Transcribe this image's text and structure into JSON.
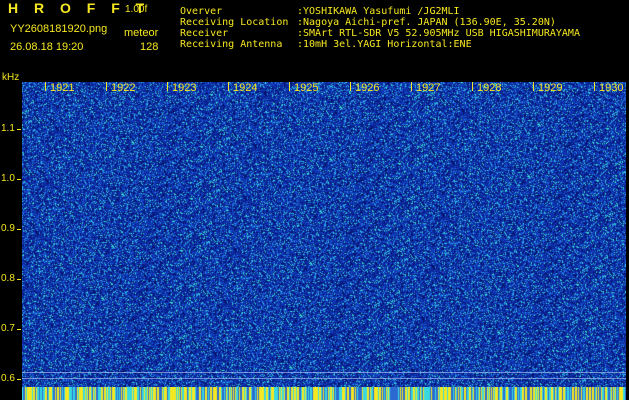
{
  "header": {
    "app_title": "H R O F F T",
    "version": "1.00f",
    "filename": "YY2608181920.png",
    "meteor_label": "meteor",
    "datetime": "26.08.18 19:20",
    "meteor_count": "128"
  },
  "info": {
    "rows": [
      {
        "key": "Overver",
        "value": ":YOSHIKAWA Yasufumi /JG2MLI"
      },
      {
        "key": "Receiving Location",
        "value": ":Nagoya Aichi-pref. JAPAN (136.90E, 35.20N)"
      },
      {
        "key": "Receiver",
        "value": ":SMArt RTL-SDR V5 52.905MHz USB HIGASHIMURAYAMA"
      },
      {
        "key": "Receiving Antenna",
        "value": ":10mH 3el.YAGI Horizontal:ENE"
      }
    ]
  },
  "axis": {
    "unit": "kHz",
    "time_ticks": [
      "1921",
      "1922",
      "1923",
      "1924",
      "1925",
      "1926",
      "1927",
      "1928",
      "1929",
      "1930"
    ],
    "freq_ticks": [
      "1.1",
      "1.0",
      "0.9",
      "0.8",
      "0.7",
      "0.6"
    ]
  },
  "colors": {
    "label": "#f6e820",
    "background": "#000000",
    "noise_base": "#123aa6",
    "noise_hot": "#3fe0d0"
  }
}
